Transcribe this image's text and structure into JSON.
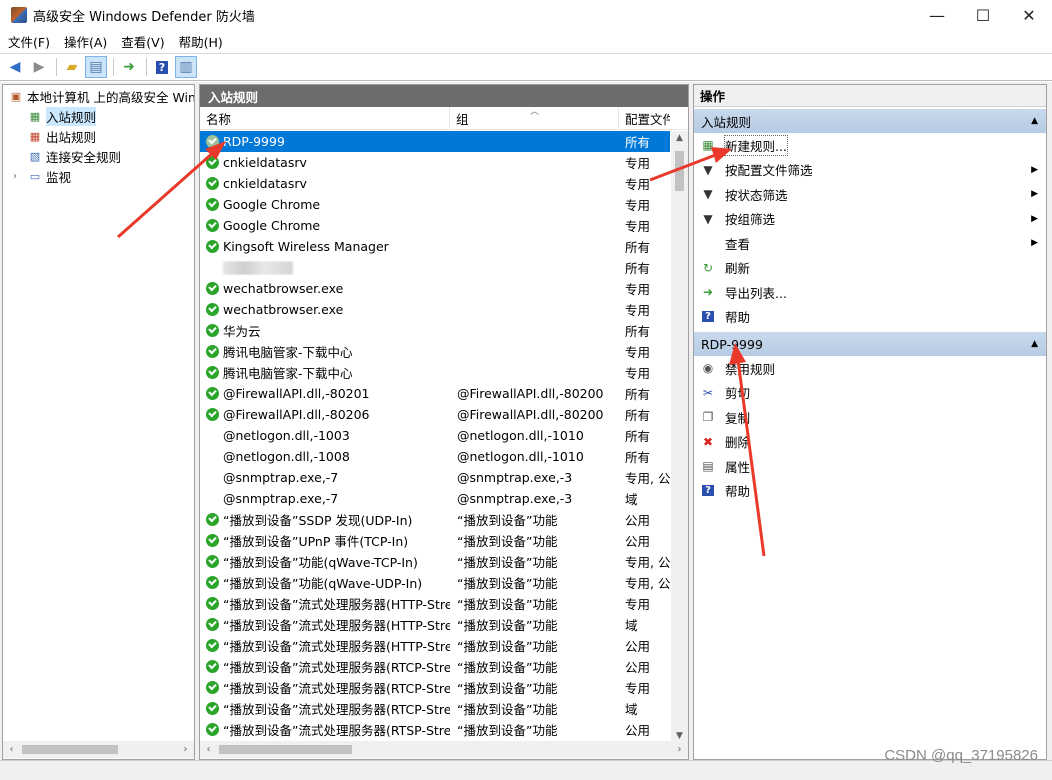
{
  "window": {
    "title": "高级安全 Windows Defender 防火墙",
    "minimize": "—",
    "maximize": "☐",
    "close": "✕"
  },
  "menu": [
    "文件(F)",
    "操作(A)",
    "查看(V)",
    "帮助(H)"
  ],
  "tree": {
    "root": "本地计算机 上的高级安全 Windows Defender 防火墙",
    "children": [
      "入站规则",
      "出站规则",
      "连接安全规则",
      "监视"
    ]
  },
  "center": {
    "header": "入站规则",
    "columns": [
      "名称",
      "组",
      "配置文件"
    ],
    "rows": [
      {
        "name": "RDP-9999",
        "group": "",
        "profile": "所有",
        "status": "on"
      },
      {
        "name": "cnkieldatasrv",
        "group": "",
        "profile": "专用",
        "status": "on"
      },
      {
        "name": "cnkieldatasrv",
        "group": "",
        "profile": "专用",
        "status": "on"
      },
      {
        "name": "Google Chrome",
        "group": "",
        "profile": "专用",
        "status": "on"
      },
      {
        "name": "Google Chrome",
        "group": "",
        "profile": "专用",
        "status": "on"
      },
      {
        "name": "Kingsoft Wireless Manager",
        "group": "",
        "profile": "所有",
        "status": "on"
      },
      {
        "name": "",
        "group": "",
        "profile": "所有",
        "status": "blur"
      },
      {
        "name": "wechatbrowser.exe",
        "group": "",
        "profile": "专用",
        "status": "on"
      },
      {
        "name": "wechatbrowser.exe",
        "group": "",
        "profile": "专用",
        "status": "on"
      },
      {
        "name": "华为云",
        "group": "",
        "profile": "所有",
        "status": "on"
      },
      {
        "name": "腾讯电脑管家-下载中心",
        "group": "",
        "profile": "专用",
        "status": "on"
      },
      {
        "name": "腾讯电脑管家-下载中心",
        "group": "",
        "profile": "专用",
        "status": "on"
      },
      {
        "name": "@FirewallAPI.dll,-80201",
        "group": "@FirewallAPI.dll,-80200",
        "profile": "所有",
        "status": "on"
      },
      {
        "name": "@FirewallAPI.dll,-80206",
        "group": "@FirewallAPI.dll,-80200",
        "profile": "所有",
        "status": "on"
      },
      {
        "name": "@netlogon.dll,-1003",
        "group": "@netlogon.dll,-1010",
        "profile": "所有",
        "status": "off"
      },
      {
        "name": "@netlogon.dll,-1008",
        "group": "@netlogon.dll,-1010",
        "profile": "所有",
        "status": "off"
      },
      {
        "name": "@snmptrap.exe,-7",
        "group": "@snmptrap.exe,-3",
        "profile": "专用, 公",
        "status": "off"
      },
      {
        "name": "@snmptrap.exe,-7",
        "group": "@snmptrap.exe,-3",
        "profile": "域",
        "status": "off"
      },
      {
        "name": "“播放到设备”SSDP 发现(UDP-In)",
        "group": "“播放到设备”功能",
        "profile": "公用",
        "status": "on"
      },
      {
        "name": "“播放到设备”UPnP 事件(TCP-In)",
        "group": "“播放到设备”功能",
        "profile": "公用",
        "status": "on"
      },
      {
        "name": "“播放到设备”功能(qWave-TCP-In)",
        "group": "“播放到设备”功能",
        "profile": "专用, 公",
        "status": "on"
      },
      {
        "name": "“播放到设备”功能(qWave-UDP-In)",
        "group": "“播放到设备”功能",
        "profile": "专用, 公",
        "status": "on"
      },
      {
        "name": "“播放到设备”流式处理服务器(HTTP-Stre...",
        "group": "“播放到设备”功能",
        "profile": "专用",
        "status": "on"
      },
      {
        "name": "“播放到设备”流式处理服务器(HTTP-Stre...",
        "group": "“播放到设备”功能",
        "profile": "域",
        "status": "on"
      },
      {
        "name": "“播放到设备”流式处理服务器(HTTP-Stre...",
        "group": "“播放到设备”功能",
        "profile": "公用",
        "status": "on"
      },
      {
        "name": "“播放到设备”流式处理服务器(RTCP-Stre...",
        "group": "“播放到设备”功能",
        "profile": "公用",
        "status": "on"
      },
      {
        "name": "“播放到设备”流式处理服务器(RTCP-Stre...",
        "group": "“播放到设备”功能",
        "profile": "专用",
        "status": "on"
      },
      {
        "name": "“播放到设备”流式处理服务器(RTCP-Stre...",
        "group": "“播放到设备”功能",
        "profile": "域",
        "status": "on"
      },
      {
        "name": "“播放到设备”流式处理服务器(RTSP-Stre...",
        "group": "“播放到设备”功能",
        "profile": "公用",
        "status": "on"
      }
    ]
  },
  "actions": {
    "header": "操作",
    "section1": "入站规则",
    "items1": [
      {
        "label": "新建规则...",
        "icon": "new-rule-icon",
        "submenu": false
      },
      {
        "label": "按配置文件筛选",
        "icon": "filter-icon",
        "submenu": true
      },
      {
        "label": "按状态筛选",
        "icon": "filter-icon",
        "submenu": true
      },
      {
        "label": "按组筛选",
        "icon": "filter-icon",
        "submenu": true
      },
      {
        "label": "查看",
        "icon": "",
        "submenu": true
      },
      {
        "label": "刷新",
        "icon": "refresh-icon",
        "submenu": false
      },
      {
        "label": "导出列表...",
        "icon": "export-icon",
        "submenu": false
      },
      {
        "label": "帮助",
        "icon": "help-icon",
        "submenu": false
      }
    ],
    "section2": "RDP-9999",
    "items2": [
      {
        "label": "禁用规则",
        "icon": "disable-icon"
      },
      {
        "label": "剪切",
        "icon": "cut-icon"
      },
      {
        "label": "复制",
        "icon": "copy-icon"
      },
      {
        "label": "删除",
        "icon": "delete-icon"
      },
      {
        "label": "属性",
        "icon": "properties-icon"
      },
      {
        "label": "帮助",
        "icon": "help-icon"
      }
    ]
  },
  "watermark": "CSDN @qq_37195826",
  "colors": {
    "selection": "#0078d7",
    "header_dark": "#6c6c6c",
    "section_blue": "#b6cbe3",
    "enabled_green": "#2aa52a",
    "annotation_red": "#e8392a"
  }
}
